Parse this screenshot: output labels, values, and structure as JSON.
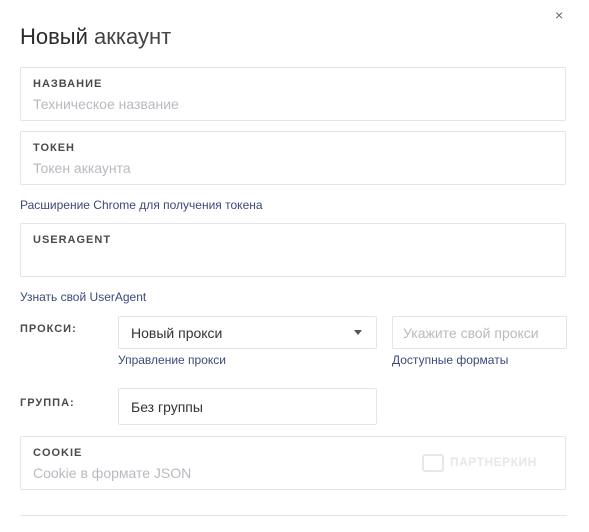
{
  "dialog": {
    "title_bold": "Новый",
    "title_light": "аккаунт",
    "close": "×"
  },
  "fields": {
    "name": {
      "label": "НАЗВАНИЕ",
      "placeholder": "Техническое название"
    },
    "token": {
      "label": "ТОКЕН",
      "placeholder": "Токен аккаунта"
    },
    "useragent": {
      "label": "USERAGENT",
      "placeholder": ""
    },
    "cookie": {
      "label": "COOKIE",
      "placeholder": "Cookie в формате JSON"
    }
  },
  "links": {
    "chrome_ext": "Расширение Chrome для получения токена",
    "user_agent": "Узнать свой UserAgent",
    "proxy_manage": "Управление прокси",
    "proxy_formats": "Доступные форматы"
  },
  "proxy": {
    "label": "ПРОКСИ:",
    "selected": "Новый прокси",
    "input_placeholder": "Укажите свой прокси"
  },
  "group": {
    "label": "ГРУППА:",
    "value": "Без группы"
  },
  "watermark": "ПАРТНЕРКИН"
}
